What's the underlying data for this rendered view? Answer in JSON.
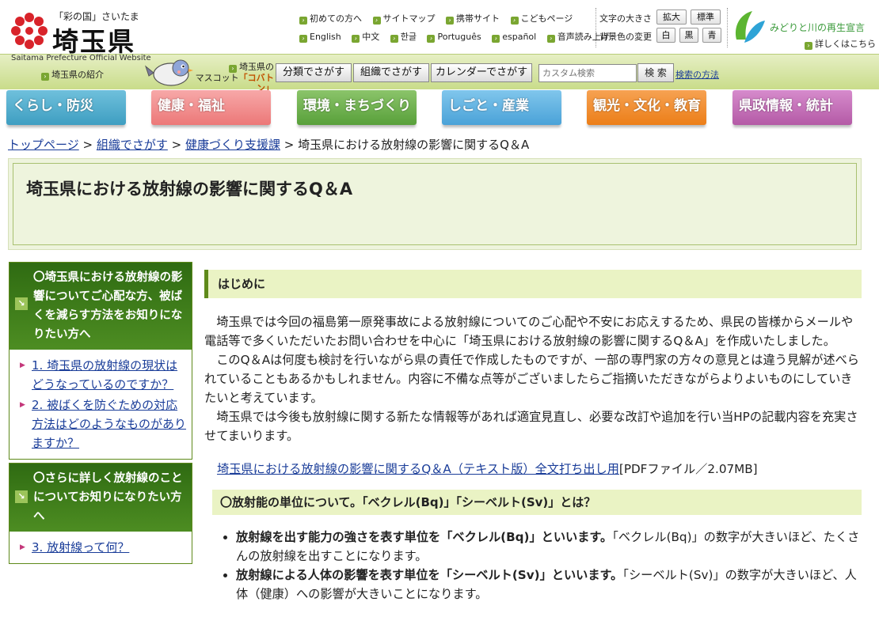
{
  "header": {
    "logo_sub": "「彩の国」さいたま",
    "logo_name": "埼玉県",
    "logo_en": "Saitama Prefecture Official Website",
    "intro_link": "埼玉県の紹介",
    "mascot_line1": "埼玉県の",
    "mascot_line2_prefix": "マスコット",
    "mascot_name": "「コバトン」",
    "util_row1": [
      "初めての方へ",
      "サイトマップ",
      "携帯サイト",
      "こどもページ"
    ],
    "util_row2": [
      "English",
      "中文",
      "한글",
      "Português",
      "español",
      "音声読み上げ"
    ],
    "font_size_label": "文字の大きさ",
    "font_size_buttons": [
      "拡大",
      "標準"
    ],
    "bg_color_label": "背景色の変更",
    "bg_color_buttons": [
      "白",
      "黒",
      "青"
    ],
    "midori_text": "みどりと川の再生宣言",
    "midori_link": "詳しくはこちら",
    "search_buttons": [
      "分類でさがす",
      "組織でさがす",
      "カレンダーでさがす"
    ],
    "search_placeholder": "カスタム検索",
    "search_go": "検 索",
    "search_help": "検索の方法"
  },
  "nav": {
    "tabs": [
      {
        "label": "くらし・防災",
        "color": "#4aa9c9"
      },
      {
        "label": "健康・福祉",
        "color": "#f28c8c"
      },
      {
        "label": "環境・まちづくり",
        "color": "#6ab04c"
      },
      {
        "label": "しごと・産業",
        "color": "#5ab0e0"
      },
      {
        "label": "観光・文化・教育",
        "color": "#f08a2a"
      },
      {
        "label": "県政情報・統計",
        "color": "#c46ab8"
      }
    ]
  },
  "breadcrumb": {
    "home": "トップページ",
    "org": "組織でさがす",
    "dept": "健康づくり支援課",
    "current": "埼玉県における放射線の影響に関するQ＆A",
    "sep": ">"
  },
  "page_title": "埼玉県における放射線の影響に関するQ＆A",
  "sidebar": [
    {
      "heading": "〇埼玉県における放射線の影響についてご心配な方、被ばくを減らす方法をお知りになりたい方へ",
      "items": [
        "1. 埼玉県の放射線の現状はどうなっているのですか？",
        "2. 被ばくを防ぐための対応方法はどのようなものがありますか？"
      ]
    },
    {
      "heading": "〇さらに詳しく放射線のことについてお知りになりたい方へ",
      "items": [
        "3. 放射線って何？"
      ]
    }
  ],
  "main": {
    "section_heading": "はじめに",
    "paragraphs": [
      "埼玉県では今回の福島第一原発事故による放射線についてのご心配や不安にお応えするため、県民の皆様からメールや電話等で多くいただいたお問い合わせを中心に「埼玉県における放射線の影響に関するQ＆A」を作成いたしました。",
      "このQ＆Aは何度も検討を行いながら県の責任で作成したものですが、一部の専門家の方々の意見とは違う見解が述べられていることもあるかもしれません。内容に不備な点等がございましたらご指摘いただきながらよりよいものにしていきたいと考えています。",
      "埼玉県では今後も放射線に関する新たな情報等があれば適宜見直し、必要な改訂や追加を行い当HPの記載内容を充実させてまいります。"
    ],
    "pdf_link": "埼玉県における放射線の影響に関するQ＆A（テキスト版）全文打ち出し用",
    "pdf_info": "[PDFファイル／2.07MB]",
    "question_heading": "〇放射能の単位について。「ベクレル(Bq)」「シーベルト(Sv)」とは？",
    "answers": [
      {
        "bold": "放射線を出す能力の強さを表す単位を「ベクレル(Bq)」といいます。",
        "text": "「ベクレル(Bq)」の数字が大きいほど、たくさんの放射線を出すことになります。"
      },
      {
        "bold": "放射線による人体の影響を表す単位を「シーベルト(Sv)」といいます。",
        "text": "「シーベルト(Sv)」の数字が大きいほど、人体（健康）への影響が大きいことになります。"
      }
    ]
  }
}
